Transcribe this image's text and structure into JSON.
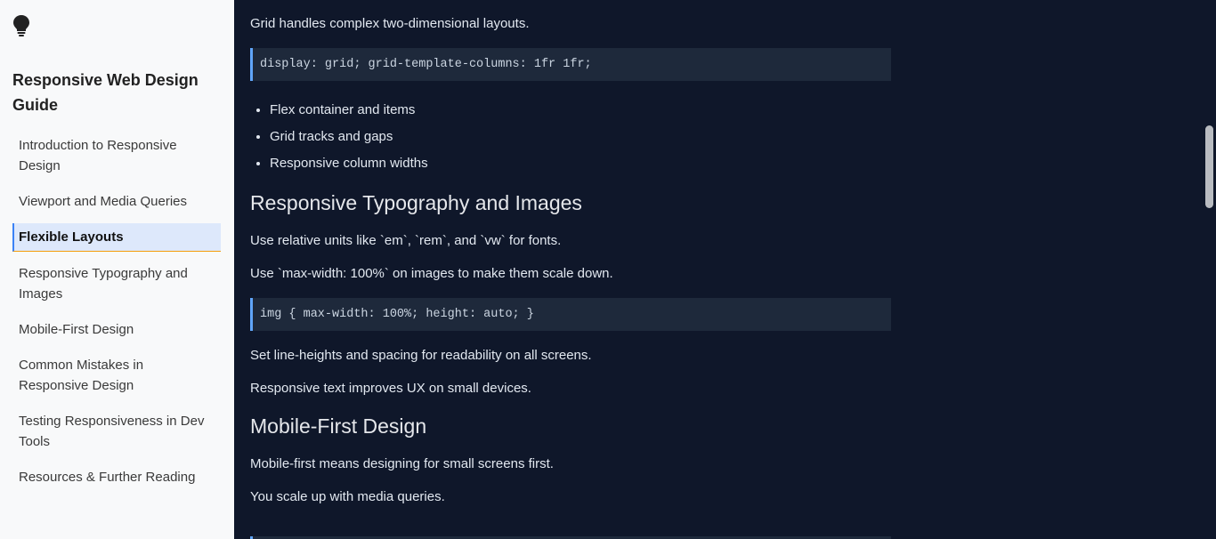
{
  "sidebar": {
    "logo_icon": "lightbulb-icon",
    "title": "Responsive Web Design Guide",
    "items": [
      {
        "label": "Introduction to Responsive Design"
      },
      {
        "label": "Viewport and Media Queries"
      },
      {
        "label": "Flexible Layouts"
      },
      {
        "label": "Responsive Typography and Images"
      },
      {
        "label": "Mobile-First Design"
      },
      {
        "label": "Common Mistakes in Responsive Design"
      },
      {
        "label": "Testing Responsiveness in Dev Tools"
      },
      {
        "label": "Resources & Further Reading"
      }
    ],
    "active_index": 2
  },
  "content": {
    "grid_intro": "Grid handles complex two-dimensional layouts.",
    "code_grid": "display: grid; grid-template-columns: 1fr 1fr;",
    "bullets": [
      "Flex container and items",
      "Grid tracks and gaps",
      "Responsive column widths"
    ],
    "typo_heading": "Responsive Typography and Images",
    "typo_p1": "Use relative units like `em`, `rem`, and `vw` for fonts.",
    "typo_p2": "Use `max-width: 100%` on images to make them scale down.",
    "code_img": "img { max-width: 100%; height: auto; }",
    "typo_p3": "Set line-heights and spacing for readability on all screens.",
    "typo_p4": "Responsive text improves UX on small devices.",
    "mobile_heading": "Mobile-First Design",
    "mobile_p1": "Mobile-first means designing for small screens first.",
    "mobile_p2": "You scale up with media queries."
  },
  "colors": {
    "sidebar_bg": "#f8f9fa",
    "main_bg": "#0f172a",
    "code_bg": "#1e293b",
    "code_accent": "#60a5fa",
    "active_bg": "#dde8fb"
  }
}
